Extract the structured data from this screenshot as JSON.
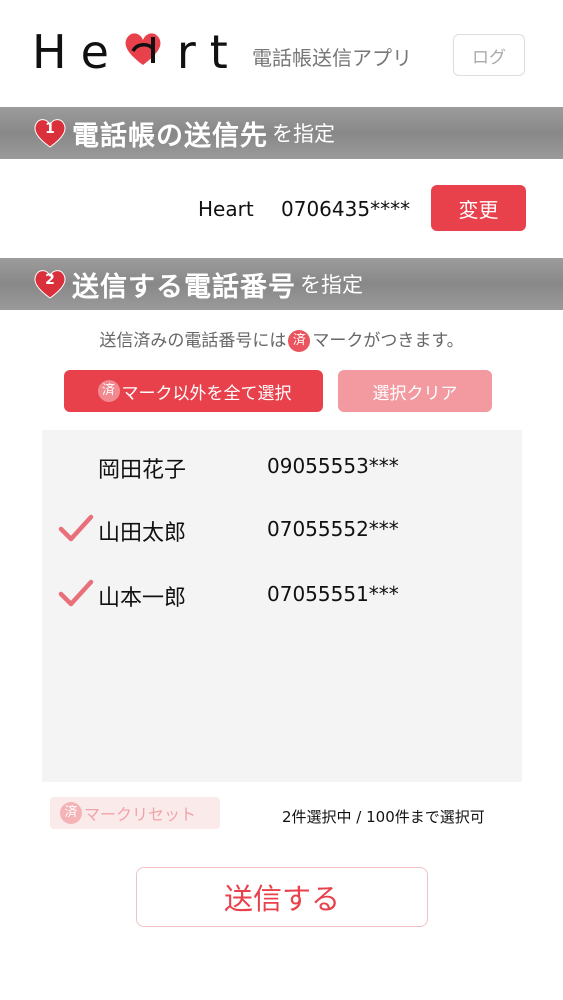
{
  "header": {
    "logo_left": "He",
    "logo_right": "rt",
    "subtitle": "電話帳送信アプリ",
    "log_button": "ログ"
  },
  "section1": {
    "number": "1",
    "title_main": "電話帳の送信先",
    "title_sub": "を指定"
  },
  "destination": {
    "name": "Heart",
    "number": "0706435****",
    "change_button": "変更"
  },
  "section2": {
    "number": "2",
    "title_main": "送信する電話番号",
    "title_sub": "を指定"
  },
  "note": {
    "before": "送信済みの電話番号には",
    "mark": "済",
    "after": "マークがつきます。"
  },
  "buttons": {
    "select_all_mark": "済",
    "select_all_label": "マーク以外を全て選択",
    "clear_label": "選択クリア",
    "reset_mark": "済",
    "reset_label": "マークリセット",
    "send_label": "送信する"
  },
  "contacts": [
    {
      "name": "岡田花子",
      "phone": "09055553***",
      "checked": false
    },
    {
      "name": "山田太郎",
      "phone": "07055552***",
      "checked": true
    },
    {
      "name": "山本一郎",
      "phone": "07055551***",
      "checked": true
    }
  ],
  "selection_status": "2件選択中 / 100件まで選択可",
  "colors": {
    "accent": "#e8414c",
    "accent_light": "#f29aa0",
    "check": "#e9707a",
    "bar": "#9a9a9a"
  }
}
